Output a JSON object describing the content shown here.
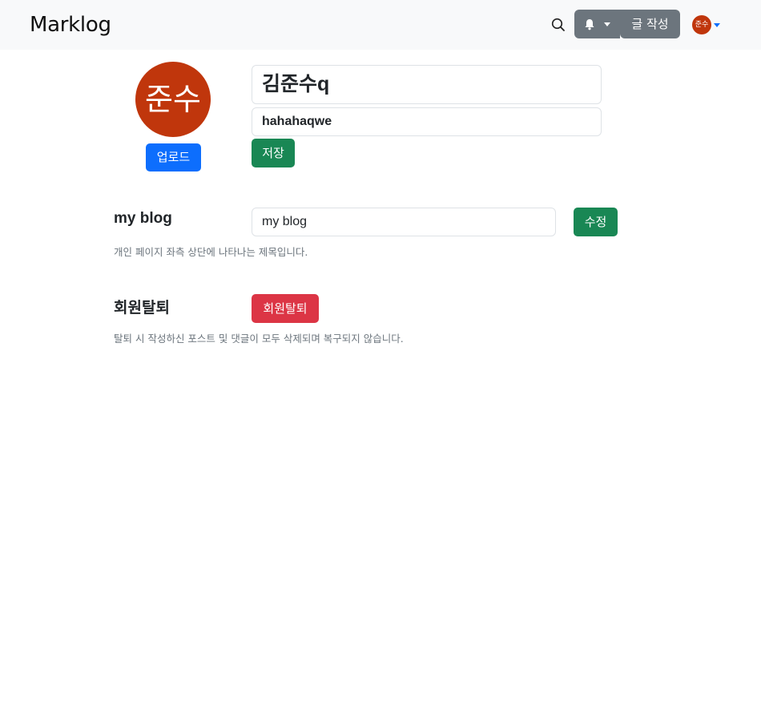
{
  "navbar": {
    "brand": "Marklog",
    "write_label": "글 작성",
    "avatar_text": "준수",
    "icons": [
      "search-icon",
      "bell-icon",
      "chevron-down-icon"
    ]
  },
  "profile": {
    "avatar_text": "준수",
    "upload_label": "업로드",
    "name_value": "김준수q",
    "bio_value": "hahahaqwe",
    "save_label": "저장"
  },
  "blog_title": {
    "heading": "my blog",
    "input_value": "my blog",
    "edit_label": "수정",
    "help": "개인 페이지 좌측 상단에 나타나는 제목입니다."
  },
  "withdraw": {
    "heading": "회원탈퇴",
    "button_label": "회원탈퇴",
    "help": "탈퇴 시 작성하신 포스트 및 댓글이 모두 삭제되며 복구되지 않습니다."
  },
  "colors": {
    "navbar_bg": "#f8f9fa",
    "secondary": "#6c757d",
    "primary": "#0d6efd",
    "success": "#198754",
    "danger": "#dc3545",
    "avatar_bg": "#c0360c"
  }
}
